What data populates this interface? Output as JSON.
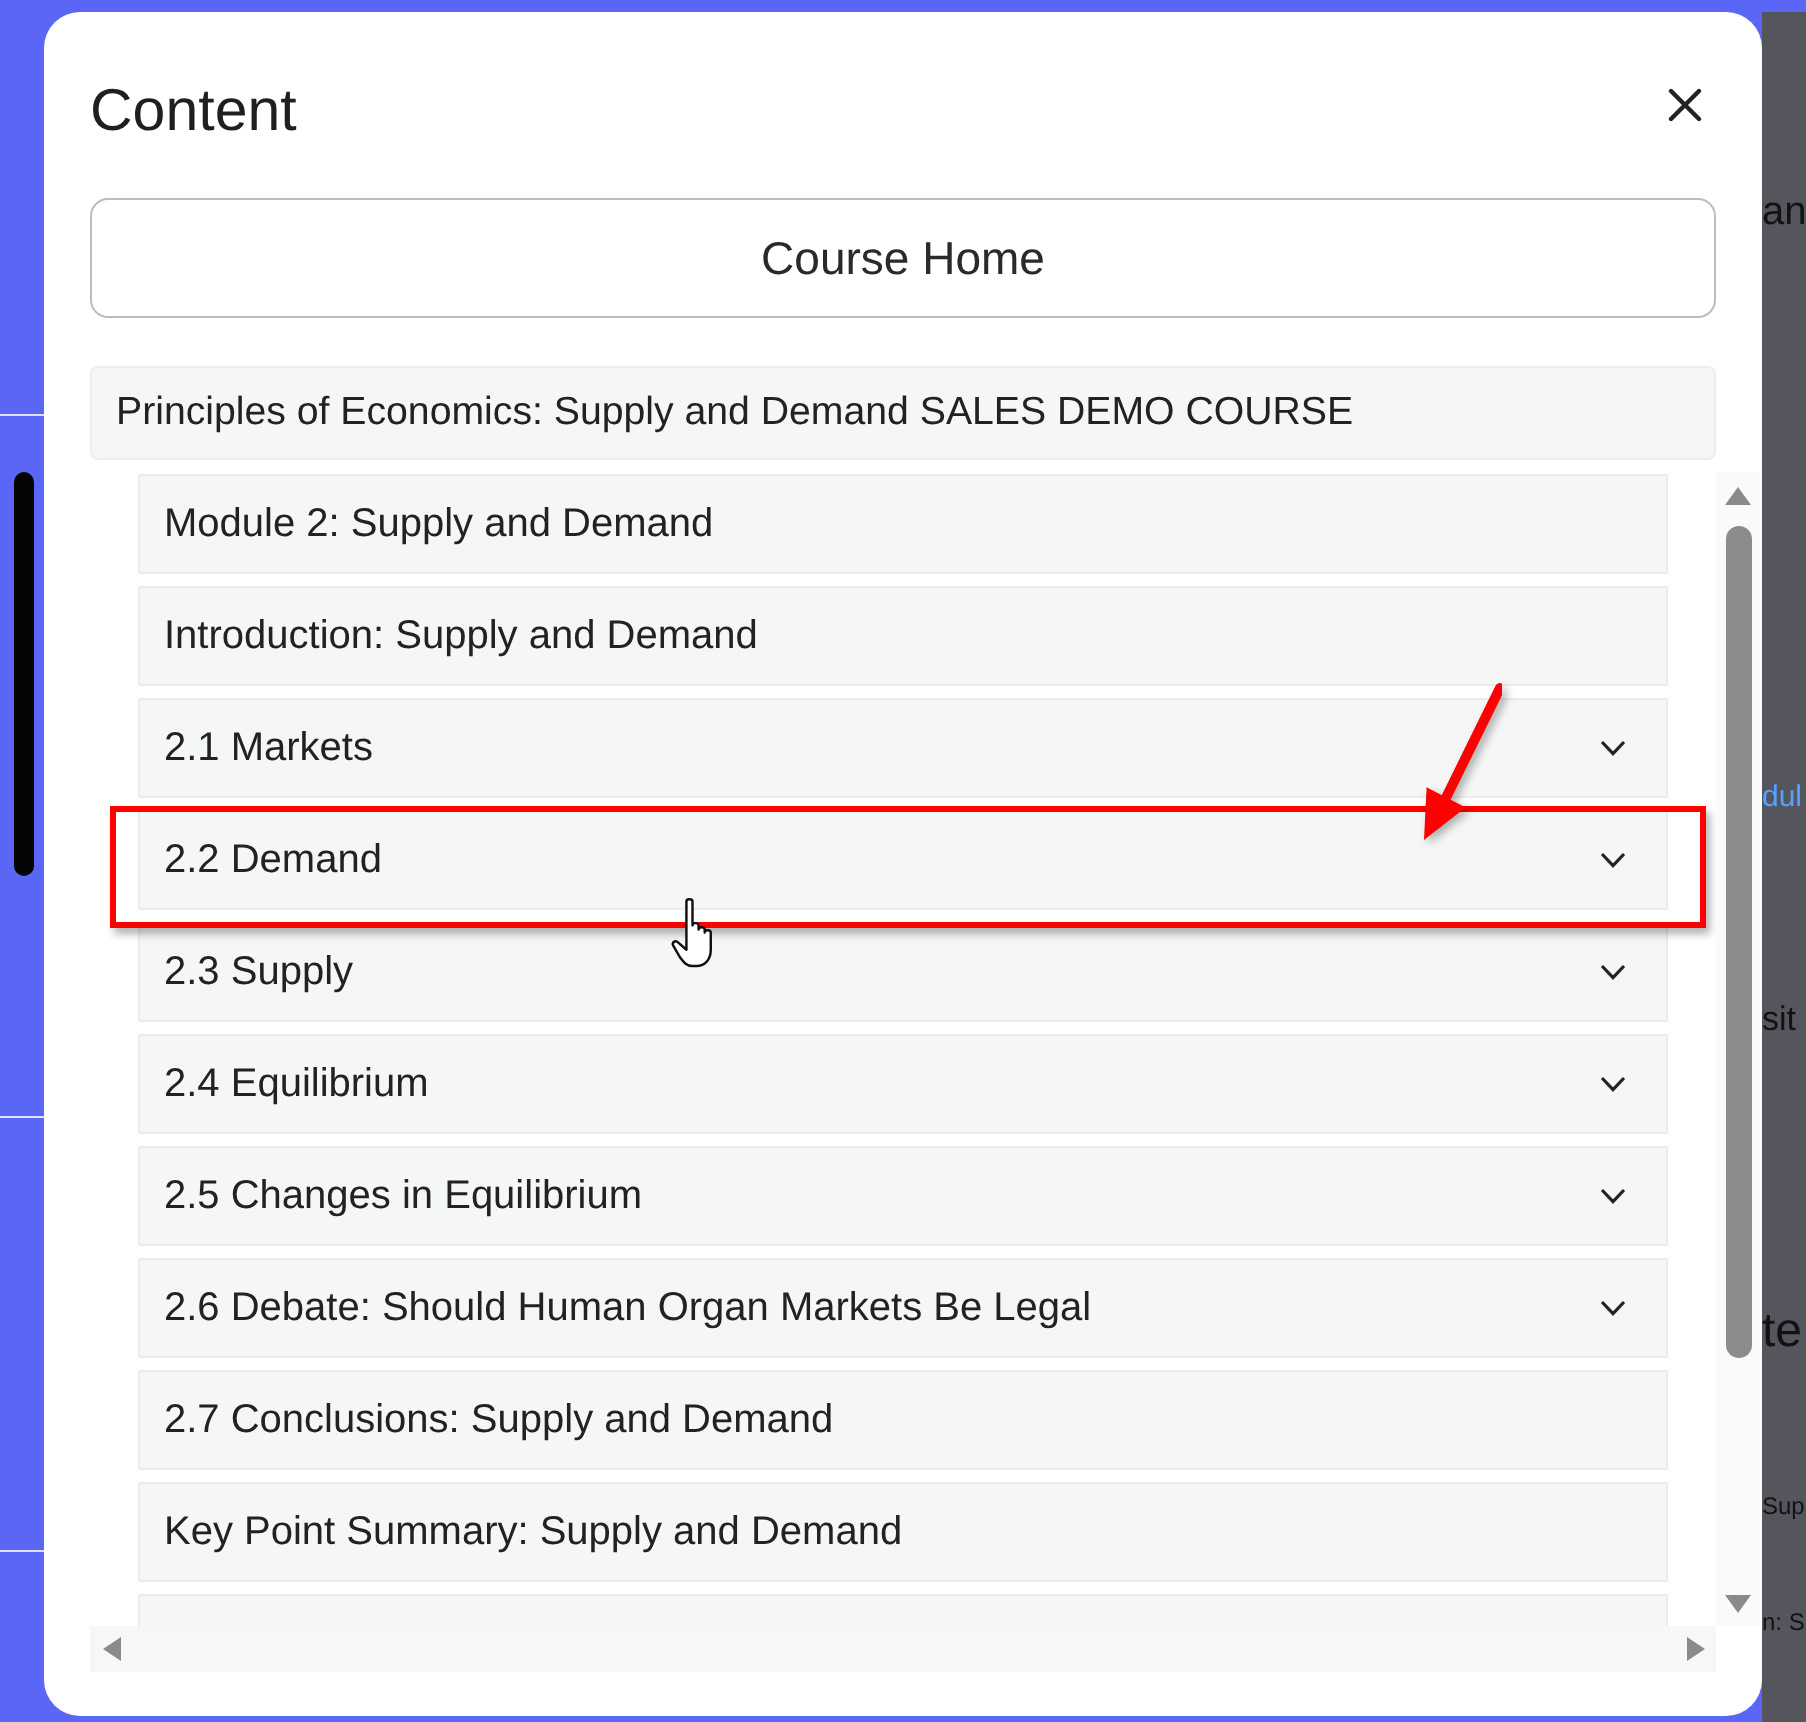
{
  "window": {
    "title": "Content"
  },
  "course_home_button": {
    "label": "Course Home"
  },
  "course": {
    "title": "Principles of Economics: Supply and Demand SALES DEMO COURSE",
    "items": [
      {
        "kind": "page",
        "label": "Module 2: Supply and Demand",
        "annotated": false,
        "hovered": false
      },
      {
        "kind": "page",
        "label": "Introduction: Supply and Demand",
        "annotated": false,
        "hovered": false
      },
      {
        "kind": "section",
        "label": "2.1 Markets",
        "expanded": false,
        "annotated": false,
        "hovered": false
      },
      {
        "kind": "section",
        "label": "2.2 Demand",
        "expanded": false,
        "annotated": true,
        "hovered": true
      },
      {
        "kind": "section",
        "label": "2.3 Supply",
        "expanded": false,
        "annotated": false,
        "hovered": false
      },
      {
        "kind": "section",
        "label": "2.4 Equilibrium",
        "expanded": false,
        "annotated": false,
        "hovered": false
      },
      {
        "kind": "section",
        "label": "2.5 Changes in Equilibrium",
        "expanded": false,
        "annotated": false,
        "hovered": false
      },
      {
        "kind": "section",
        "label": "2.6 Debate: Should Human Organ Markets Be Legal",
        "expanded": false,
        "annotated": false,
        "hovered": false
      },
      {
        "kind": "page",
        "label": "2.7 Conclusions: Supply and Demand",
        "annotated": false,
        "hovered": false
      },
      {
        "kind": "page",
        "label": "Key Point Summary: Supply and Demand",
        "annotated": false,
        "hovered": false
      },
      {
        "kind": "page",
        "annotated": false,
        "hovered": false
      }
    ]
  },
  "background_page": {
    "fragments": [
      {
        "kind": "text",
        "text": "an"
      },
      {
        "kind": "link",
        "text": "dul"
      },
      {
        "kind": "text",
        "text": "sit"
      },
      {
        "kind": "text",
        "text": "te"
      },
      {
        "kind": "text",
        "text": "Sup"
      },
      {
        "kind": "text",
        "text": "n: S"
      }
    ]
  }
}
